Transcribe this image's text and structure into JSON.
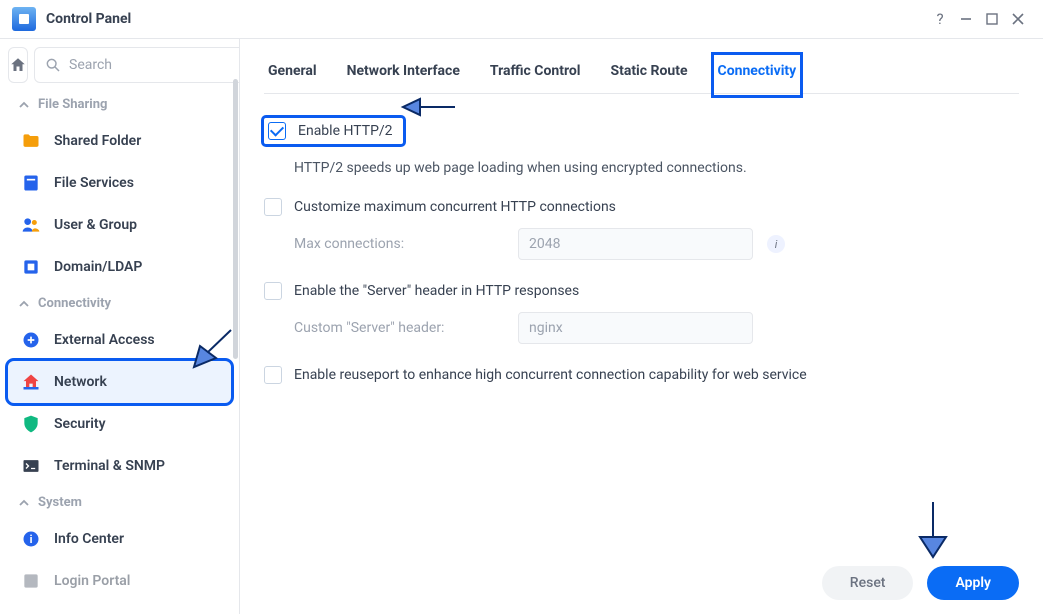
{
  "window": {
    "title": "Control Panel"
  },
  "search": {
    "placeholder": "Search"
  },
  "sections": {
    "file_sharing": "File Sharing",
    "connectivity": "Connectivity",
    "system": "System"
  },
  "sidebar": {
    "items": [
      {
        "label": "Shared Folder"
      },
      {
        "label": "File Services"
      },
      {
        "label": "User & Group"
      },
      {
        "label": "Domain/LDAP"
      },
      {
        "label": "External Access"
      },
      {
        "label": "Network"
      },
      {
        "label": "Security"
      },
      {
        "label": "Terminal & SNMP"
      },
      {
        "label": "Info Center"
      },
      {
        "label": "Login Portal"
      }
    ]
  },
  "tabs": {
    "general": "General",
    "network_interface": "Network Interface",
    "traffic_control": "Traffic Control",
    "static_route": "Static Route",
    "connectivity": "Connectivity"
  },
  "options": {
    "enable_http2": "Enable HTTP/2",
    "http2_desc": "HTTP/2 speeds up web page loading when using encrypted connections.",
    "customize_max": "Customize maximum concurrent HTTP connections",
    "max_conn_label": "Max connections:",
    "max_conn_value": "2048",
    "enable_server_header": "Enable the \"Server\" header in HTTP responses",
    "custom_server_label": "Custom \"Server\" header:",
    "custom_server_value": "nginx",
    "enable_reuseport": "Enable reuseport to enhance high concurrent connection capability for web service"
  },
  "buttons": {
    "reset": "Reset",
    "apply": "Apply"
  }
}
